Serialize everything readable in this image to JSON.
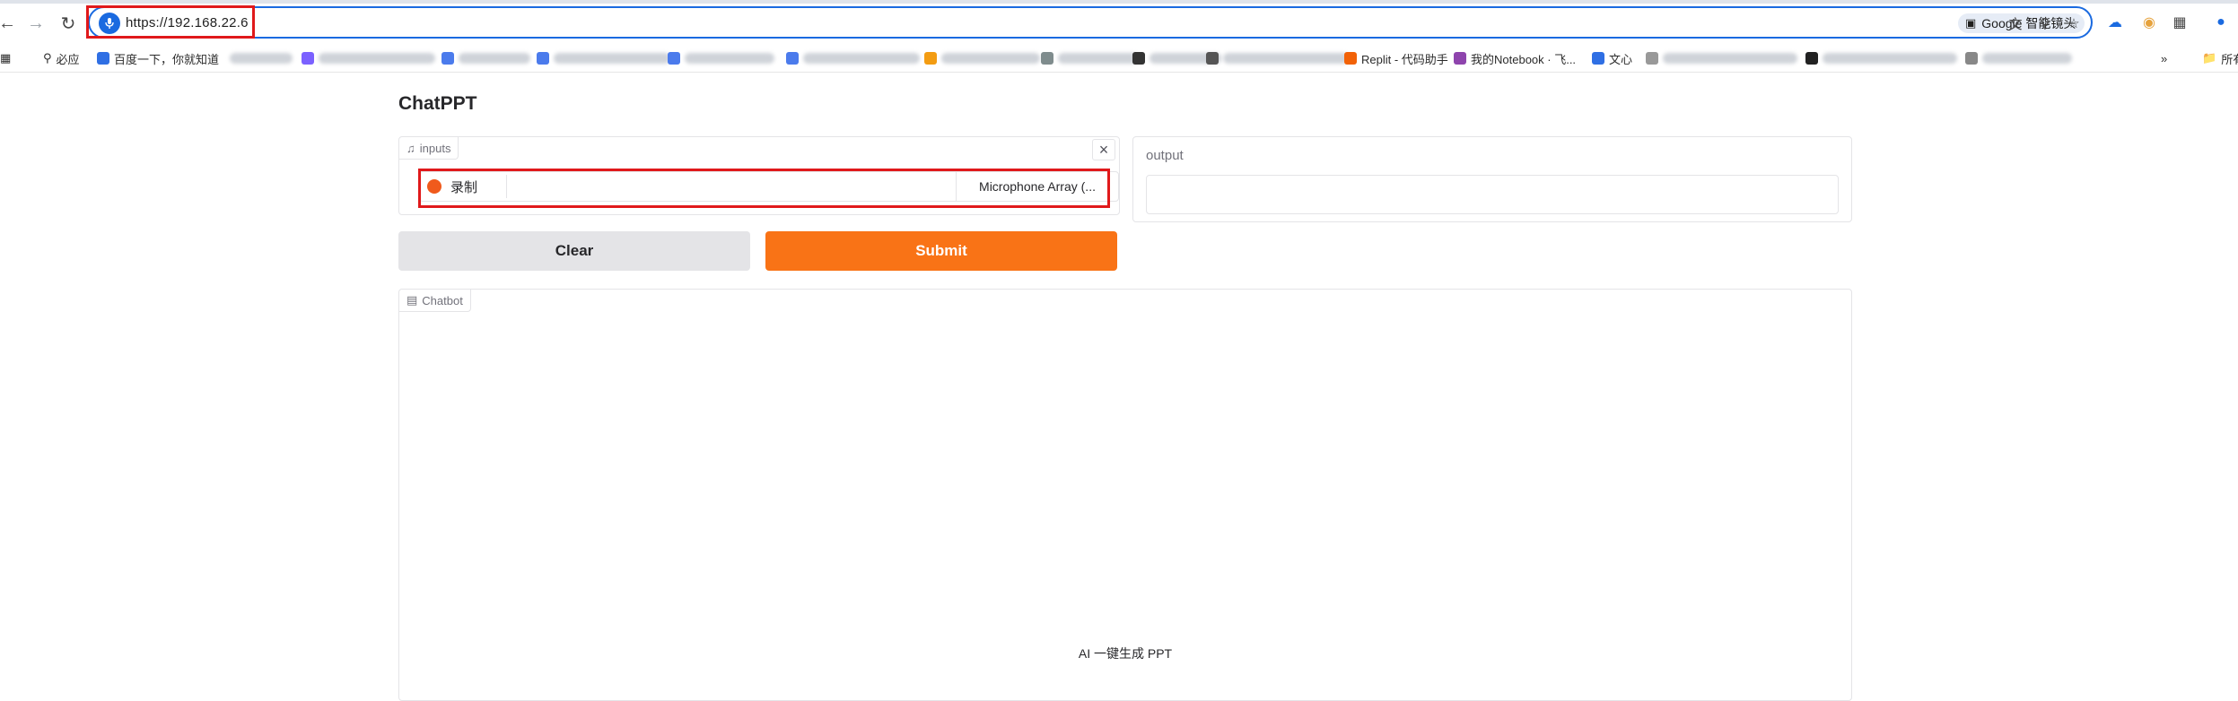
{
  "browser": {
    "url": "https://192.168.22.6",
    "lens_label": "Google 智能镜头",
    "accent_color": "#1a6ae0",
    "highlight_color": "#e0191b",
    "bookmarks": [
      {
        "label": "必应",
        "icon": "search-icon"
      },
      {
        "label": "百度一下，你就知道",
        "icon": "paw-icon"
      },
      {
        "label": "Replit - 代码助手",
        "icon": "replit-icon"
      },
      {
        "label": "我的Notebook · 飞...",
        "icon": "notebook-icon"
      },
      {
        "label": "文心",
        "icon": "wenxin-icon"
      },
      {
        "label": "所有书签",
        "icon": "folder-icon"
      }
    ]
  },
  "app": {
    "title": "ChatPPT",
    "inputs": {
      "label": "inputs",
      "record_label": "录制",
      "microphone_label": "Microphone Array (..."
    },
    "output": {
      "label": "output",
      "value": ""
    },
    "buttons": {
      "clear": "Clear",
      "submit": "Submit"
    },
    "chatbot": {
      "label": "Chatbot",
      "message": "AI 一键生成 PPT"
    },
    "colors": {
      "primary": "#f97316",
      "secondary": "#e4e4e7",
      "record": "#f05a1c"
    }
  }
}
